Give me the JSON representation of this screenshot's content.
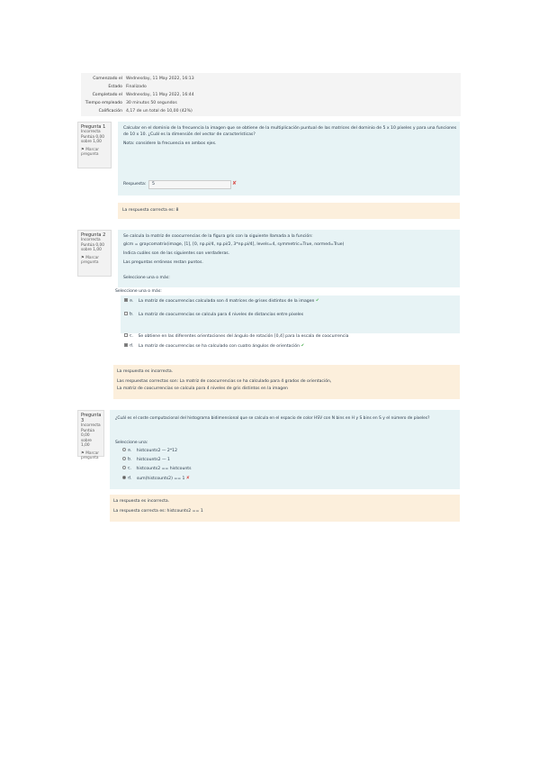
{
  "summary": {
    "rows": [
      {
        "label": "Comenzado el",
        "value": "Wednesday, 11 May 2022, 16:13"
      },
      {
        "label": "Estado",
        "value": "Finalizado"
      },
      {
        "label": "Completado el",
        "value": "Wednesday, 11 May 2022, 16:44"
      },
      {
        "label": "Tiempo empleado",
        "value": "30 minutos 50 segundos"
      },
      {
        "label": "Calificación",
        "value": "4,17 de un total de 10,00 (42%)"
      }
    ]
  },
  "q1": {
    "info": {
      "number": "Pregunta 1",
      "state": "Incorrecta",
      "mark": "Puntúa 0,00 sobre 1,00",
      "flag": "Marcar pregunta"
    },
    "text": [
      "Calcular en el dominio de la frecuencia la imagen que se obtiene de la multiplicación puntual de las matrices del dominio de 5 x 10 píxeles y para una funciones",
      "de 10 x 10. ¿Cuál es la dimensión del vector de características?"
    ],
    "note": "Nota: considere la frecuencia en ambos ejes.",
    "answer_label": "Respuesta:",
    "answer_value": "5",
    "feedback": "La respuesta correcta es: 8"
  },
  "q2": {
    "info": {
      "number": "Pregunta 2",
      "state": "Incorrecta",
      "mark": "Puntúa 0,00 sobre 1,00",
      "flag": "Marcar pregunta"
    },
    "text": [
      "Se calcula la matriz de coocurrencias de la figura gris con la siguiente llamada a la función:",
      "glcm = graycomatrix(image, [1], [0, np.pi/4, np.pi/2, 3*np.pi/4], levels=4, symmetric=True, normed=True)",
      "Indica cuáles son de las siguientes son verdaderas.",
      "Las preguntas erróneas restan puntos.",
      "Seleccione una o más:"
    ],
    "options_label": "Seleccione una o más:",
    "options": [
      {
        "letter": "a.",
        "text": "La matriz de coocurrencias calculada son 4 matrices de grises distintos de la imagen",
        "mark": "✔"
      },
      {
        "letter": "b.",
        "text": "La matriz de coocurrencias se calcula para 4 niveles de distancias entre píxeles",
        "mark": ""
      },
      {
        "letter": "c.",
        "text": "Se obtiene en las diferentes orientaciones del ángulo de rotación [0,4] para la escala de coocurrencia",
        "mark": ""
      },
      {
        "letter": "d.",
        "text": "La matriz de coocurrencias se ha calculado con cuatro ángulos de orientación",
        "mark": "✔"
      }
    ],
    "feedback": [
      "La respuesta es incorrecta.",
      "Las respuestas correctas son: La matriz de coocurrencias se ha calculado para 4 grados de orientación,",
      "La matriz de coocurrencias se calcula para 4 niveles de gris distintos en la imagen"
    ]
  },
  "q3": {
    "info": {
      "number": "Pregunta 3",
      "state": "Incorrecta",
      "mark": "Puntúa 0,00 sobre 1,00",
      "flag": "Marcar pregunta"
    },
    "text": "¿Cuál es el coste computacional del histograma bidimensional que se calcula en el espacio de color HSV con N bins en H y S bins en S y el número de píxeles?",
    "options_label": "Seleccione una:",
    "options": [
      {
        "letter": "a.",
        "text": "histcounts2 — 2*12",
        "mark": ""
      },
      {
        "letter": "b.",
        "text": "histcounts2 — 1",
        "mark": ""
      },
      {
        "letter": "c.",
        "text": "histcounts2 == histcounts",
        "mark": ""
      },
      {
        "letter": "d.",
        "text": "sum(histcounts2) == 1",
        "mark": "✘"
      }
    ],
    "feedback": [
      "La respuesta es incorrecta.",
      "La respuesta correcta es: histcounts2 == 1"
    ]
  },
  "colors": {
    "question_bg": "#e7f3f5",
    "feedback_bg": "#fcefdc",
    "summary_bg": "#f4f4f4"
  }
}
